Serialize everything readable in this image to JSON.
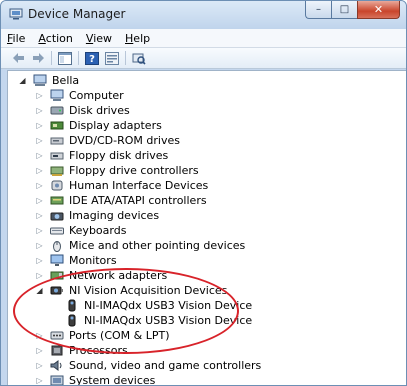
{
  "window": {
    "title": "Device Manager",
    "buttons": {
      "minimize": "–",
      "maximize": "□",
      "close": "✕"
    }
  },
  "menu": [
    "File",
    "Action",
    "View",
    "Help"
  ],
  "tree": {
    "root": "Bella",
    "categories": [
      {
        "label": "Computer",
        "icon": "computer-icon"
      },
      {
        "label": "Disk drives",
        "icon": "disk-drive-icon"
      },
      {
        "label": "Display adapters",
        "icon": "display-adapter-icon"
      },
      {
        "label": "DVD/CD-ROM drives",
        "icon": "dvd-drive-icon"
      },
      {
        "label": "Floppy disk drives",
        "icon": "floppy-disk-icon"
      },
      {
        "label": "Floppy drive controllers",
        "icon": "floppy-controller-icon"
      },
      {
        "label": "Human Interface Devices",
        "icon": "hid-icon"
      },
      {
        "label": "IDE ATA/ATAPI controllers",
        "icon": "ide-controller-icon"
      },
      {
        "label": "Imaging devices",
        "icon": "camera-icon"
      },
      {
        "label": "Keyboards",
        "icon": "keyboard-icon"
      },
      {
        "label": "Mice and other pointing devices",
        "icon": "mouse-icon"
      },
      {
        "label": "Monitors",
        "icon": "monitor-icon"
      },
      {
        "label": "Network adapters",
        "icon": "network-adapter-icon"
      },
      {
        "label": "NI Vision Acquisition Devices",
        "icon": "vision-device-icon",
        "expanded": true,
        "children": [
          "NI-IMAQdx USB3 Vision Device",
          "NI-IMAQdx USB3 Vision Device"
        ]
      },
      {
        "label": "Ports (COM & LPT)",
        "icon": "port-icon"
      },
      {
        "label": "Processors",
        "icon": "processor-icon"
      },
      {
        "label": "Sound, video and game controllers",
        "icon": "sound-icon"
      },
      {
        "label": "System devices",
        "icon": "system-devices-icon"
      }
    ]
  },
  "colors": {
    "highlight": "#d8232a",
    "titlebar": "#c4d7ee"
  }
}
